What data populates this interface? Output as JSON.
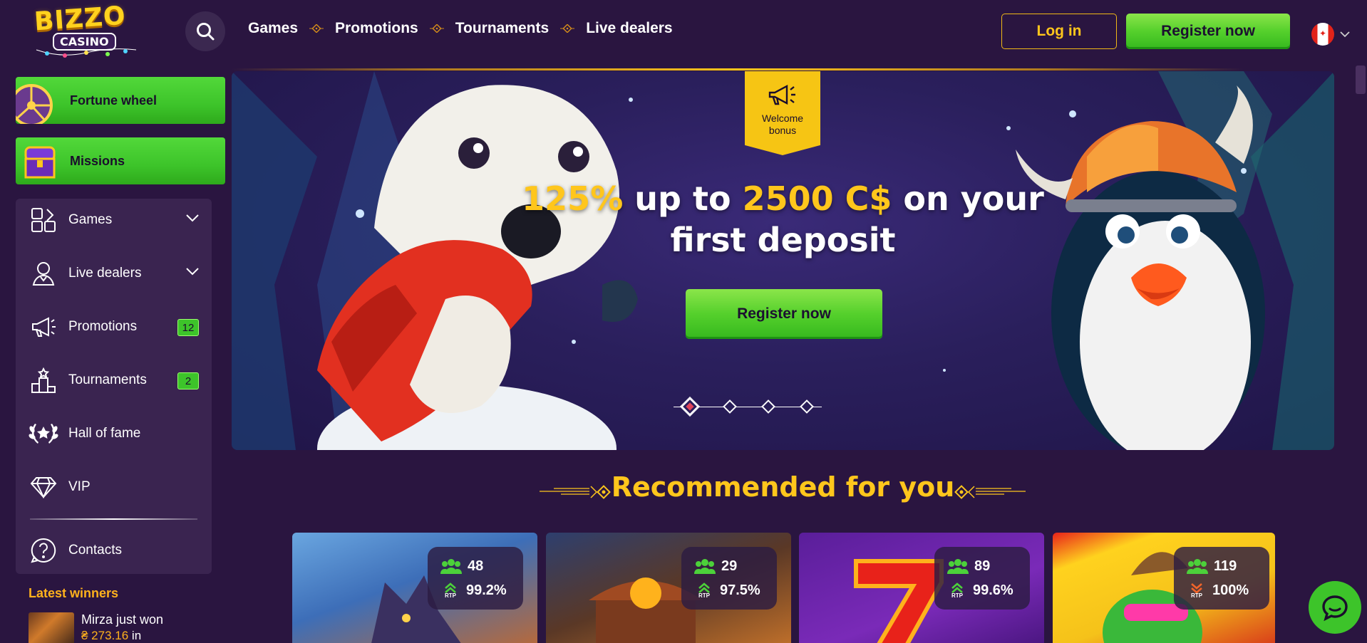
{
  "header": {
    "logo_text": "BIZZO",
    "logo_sub": "CASINO",
    "nav": [
      "Games",
      "Promotions",
      "Tournaments",
      "Live dealers"
    ],
    "login_label": "Log in",
    "register_label": "Register now",
    "language": "CA"
  },
  "sidebar": {
    "promos": [
      {
        "label": "Fortune wheel"
      },
      {
        "label": "Missions"
      }
    ],
    "menu": [
      {
        "label": "Games"
      },
      {
        "label": "Live dealers"
      },
      {
        "label": "Promotions",
        "badge": "12"
      },
      {
        "label": "Tournaments",
        "badge": "2"
      },
      {
        "label": "Hall of fame"
      },
      {
        "label": "VIP"
      },
      {
        "label": "Contacts"
      }
    ],
    "latest_winners_title": "Latest winners",
    "winner": {
      "name_text": "Mirza just won",
      "amount": "₴ 273.16",
      "suffix": " in"
    }
  },
  "hero": {
    "badge_label": "Welcome bonus",
    "title_pct": "125%",
    "title_mid": " up to ",
    "title_amount": "2500 C$",
    "title_rest_1": " on your",
    "title_rest_2": "first deposit",
    "cta_label": "Register now",
    "slides": 4,
    "active_slide": 0
  },
  "recommended": {
    "title": "Recommended for you",
    "games": [
      {
        "players": "48",
        "rtp": "99.2%",
        "trend": "up"
      },
      {
        "players": "29",
        "rtp": "97.5%",
        "trend": "up"
      },
      {
        "players": "89",
        "rtp": "99.6%",
        "trend": "up"
      },
      {
        "players": "119",
        "rtp": "100%",
        "trend": "down"
      }
    ]
  },
  "colors": {
    "background": "#2a1540",
    "accent_yellow": "#ffc61c",
    "accent_green": "#3dc42a",
    "panel": "#3a2450"
  }
}
